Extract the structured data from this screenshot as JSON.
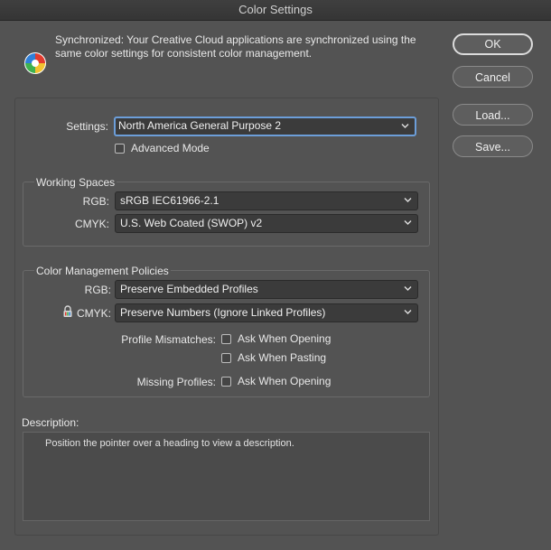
{
  "window": {
    "title": "Color Settings"
  },
  "sync": {
    "message": "Synchronized: Your Creative Cloud applications are synchronized using the same color settings for consistent color management.",
    "icon": "sync-color-wheel-icon"
  },
  "buttons": {
    "ok": "OK",
    "cancel": "Cancel",
    "load": "Load...",
    "save": "Save..."
  },
  "settings": {
    "label": "Settings:",
    "value": "North America General Purpose 2",
    "advanced_mode_label": "Advanced Mode",
    "advanced_mode_checked": false
  },
  "working_spaces": {
    "title": "Working Spaces",
    "rgb_label": "RGB:",
    "rgb_value": "sRGB IEC61966-2.1",
    "cmyk_label": "CMYK:",
    "cmyk_value": "U.S. Web Coated (SWOP) v2"
  },
  "policies": {
    "title": "Color Management Policies",
    "rgb_label": "RGB:",
    "rgb_value": "Preserve Embedded Profiles",
    "cmyk_label": "CMYK:",
    "cmyk_value": "Preserve Numbers (Ignore Linked Profiles)",
    "mismatch_label": "Profile Mismatches:",
    "ask_opening_label": "Ask When Opening",
    "ask_pasting_label": "Ask When Pasting",
    "missing_label": "Missing Profiles:",
    "missing_ask_opening_label": "Ask When Opening"
  },
  "description": {
    "label": "Description:",
    "text": "Position the pointer over a heading to view a description."
  },
  "colors": {
    "background": "#535353",
    "focus": "#6c9ed9",
    "field": "#3b3b3b"
  }
}
